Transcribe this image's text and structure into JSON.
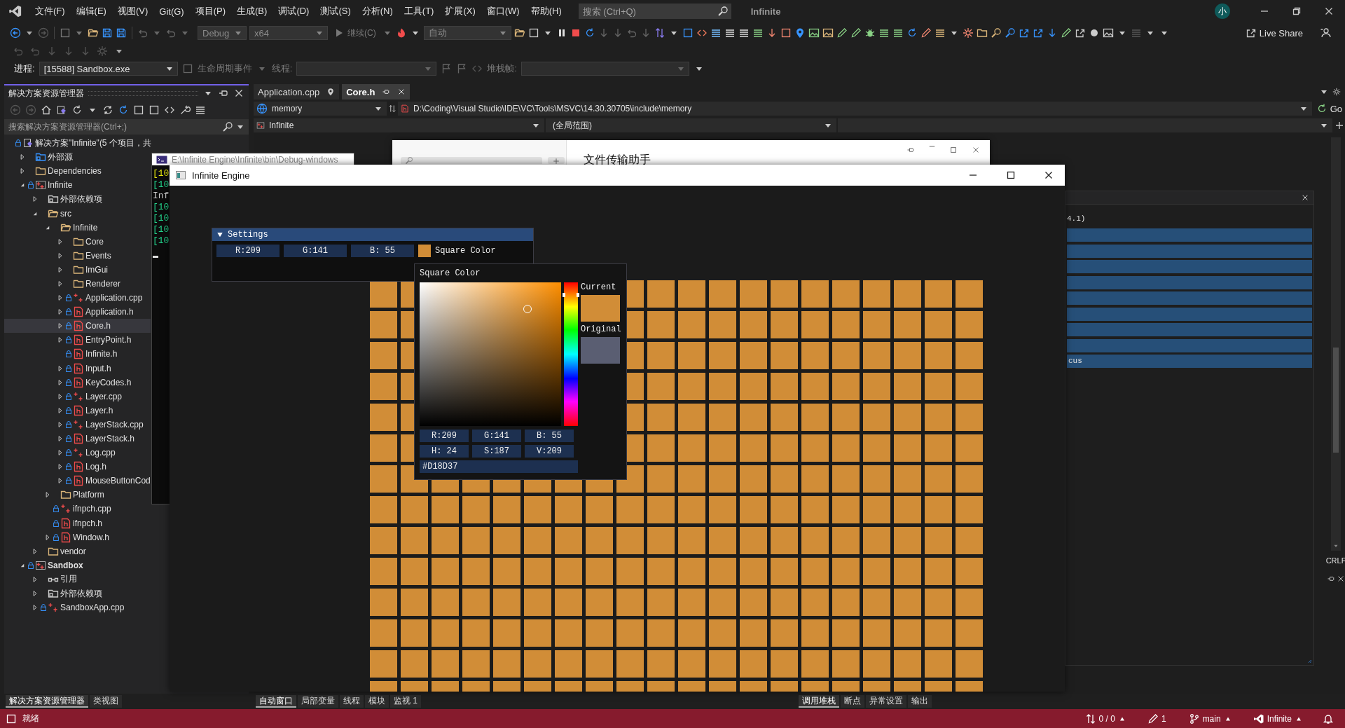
{
  "menubar": {
    "items": [
      "文件(F)",
      "编辑(E)",
      "视图(V)",
      "Git(G)",
      "项目(P)",
      "生成(B)",
      "调试(D)",
      "测试(S)",
      "分析(N)",
      "工具(T)",
      "扩展(X)",
      "窗口(W)",
      "帮助(H)"
    ],
    "search": {
      "placeholder": "搜索 (Ctrl+Q)"
    },
    "solution_name": "Infinite",
    "avatar": "小"
  },
  "toolbar": {
    "config": "Debug",
    "platform": "x64",
    "continue": "继续(C)",
    "mode": "自动",
    "live_share": "Live Share"
  },
  "debug_location": {
    "process_label": "进程:",
    "process": "[15588] Sandbox.exe",
    "lifecycle": "生命周期事件",
    "thread_label": "线程:",
    "stack_label": "堆栈帧:"
  },
  "explorer": {
    "title": "解决方案资源管理器",
    "search": {
      "placeholder": "搜索解决方案资源管理器(Ctrl+;)"
    },
    "tree": [
      {
        "label": "解决方案\"Infinite\"(5 个项目，共",
        "kind": "solution",
        "locked": true,
        "selected": false,
        "children": [
          {
            "label": "外部源",
            "kind": "extsrc",
            "locked": false,
            "selected": false,
            "expanded": false
          },
          {
            "label": "Dependencies",
            "kind": "folder",
            "locked": false,
            "selected": false,
            "expanded": false
          },
          {
            "label": "Infinite",
            "kind": "project",
            "locked": true,
            "selected": false,
            "expanded": true,
            "startup": false,
            "children": [
              {
                "label": "外部依赖项",
                "kind": "extdeps",
                "locked": false,
                "selected": false,
                "expanded": false
              },
              {
                "label": "src",
                "kind": "folder",
                "locked": false,
                "selected": false,
                "expanded": true,
                "children": [
                  {
                    "label": "Infinite",
                    "kind": "folder",
                    "locked": false,
                    "selected": false,
                    "expanded": true,
                    "children": [
                      {
                        "label": "Core",
                        "kind": "folder",
                        "locked": false,
                        "selected": false,
                        "expanded": false
                      },
                      {
                        "label": "Events",
                        "kind": "folder",
                        "locked": false,
                        "selected": false,
                        "expanded": false
                      },
                      {
                        "label": "ImGui",
                        "kind": "folder",
                        "locked": false,
                        "selected": false,
                        "expanded": false
                      },
                      {
                        "label": "Renderer",
                        "kind": "folder",
                        "locked": false,
                        "selected": false,
                        "expanded": false
                      },
                      {
                        "label": "Application.cpp",
                        "kind": "cpp",
                        "locked": true,
                        "selected": false,
                        "expanded": false
                      },
                      {
                        "label": "Application.h",
                        "kind": "h",
                        "locked": true,
                        "selected": false,
                        "expanded": false
                      },
                      {
                        "label": "Core.h",
                        "kind": "h",
                        "locked": true,
                        "selected": true,
                        "expanded": false
                      },
                      {
                        "label": "EntryPoint.h",
                        "kind": "h",
                        "locked": true,
                        "selected": false,
                        "expanded": false
                      },
                      {
                        "label": "Infinite.h",
                        "kind": "h",
                        "locked": true,
                        "selected": false
                      },
                      {
                        "label": "Input.h",
                        "kind": "h",
                        "locked": true,
                        "selected": false,
                        "expanded": false
                      },
                      {
                        "label": "KeyCodes.h",
                        "kind": "h",
                        "locked": true,
                        "selected": false,
                        "expanded": false
                      },
                      {
                        "label": "Layer.cpp",
                        "kind": "cpp",
                        "locked": true,
                        "selected": false,
                        "expanded": false
                      },
                      {
                        "label": "Layer.h",
                        "kind": "h",
                        "locked": true,
                        "selected": false,
                        "expanded": false
                      },
                      {
                        "label": "LayerStack.cpp",
                        "kind": "cpp",
                        "locked": true,
                        "selected": false,
                        "expanded": false
                      },
                      {
                        "label": "LayerStack.h",
                        "kind": "h",
                        "locked": true,
                        "selected": false,
                        "expanded": false
                      },
                      {
                        "label": "Log.cpp",
                        "kind": "cpp",
                        "locked": true,
                        "selected": false,
                        "expanded": false
                      },
                      {
                        "label": "Log.h",
                        "kind": "h",
                        "locked": true,
                        "selected": false,
                        "expanded": false
                      },
                      {
                        "label": "MouseButtonCod",
                        "kind": "h",
                        "locked": true,
                        "selected": false,
                        "expanded": false
                      }
                    ]
                  },
                  {
                    "label": "Platform",
                    "kind": "folder",
                    "locked": false,
                    "selected": false,
                    "expanded": false
                  },
                  {
                    "label": "ifnpch.cpp",
                    "kind": "cpp",
                    "locked": true,
                    "selected": false
                  },
                  {
                    "label": "ifnpch.h",
                    "kind": "h",
                    "locked": true,
                    "selected": false
                  },
                  {
                    "label": "Window.h",
                    "kind": "h",
                    "locked": true,
                    "selected": false,
                    "expanded": false
                  }
                ]
              },
              {
                "label": "vendor",
                "kind": "folder",
                "locked": false,
                "selected": false,
                "expanded": false
              }
            ]
          },
          {
            "label": "Sandbox",
            "kind": "project",
            "locked": true,
            "selected": false,
            "expanded": true,
            "startup": true,
            "children": [
              {
                "label": "引用",
                "kind": "refs",
                "locked": false,
                "selected": false,
                "expanded": false
              },
              {
                "label": "外部依赖项",
                "kind": "extdeps",
                "locked": false,
                "selected": false,
                "expanded": false
              },
              {
                "label": "SandboxApp.cpp",
                "kind": "cpp",
                "locked": true,
                "selected": false,
                "expanded": false
              }
            ]
          }
        ]
      }
    ]
  },
  "editor": {
    "tabs": [
      {
        "label": "Application.cpp",
        "selected": false,
        "pinned": true
      },
      {
        "label": "Core.h",
        "selected": true,
        "pinned": false
      }
    ],
    "navigation": {
      "scope": "memory",
      "path": "D:\\Coding\\Visual Studio\\IDE\\VC\\Tools\\MSVC\\14.30.30705\\include\\memory",
      "go": "Go",
      "project": "Infinite",
      "range": "(全局范围)"
    },
    "line_ending": "CRLF"
  },
  "console": {
    "title": "E:\\Infinite Engine\\Infinite\\bin\\Debug-windows",
    "lines": [
      {
        "text": "[10",
        "kind": "warn"
      },
      {
        "text": "[10",
        "kind": "info"
      },
      {
        "text": "Inf",
        "kind": "plain"
      },
      {
        "text": "[10",
        "kind": "info"
      },
      {
        "text": "[10",
        "kind": "info"
      },
      {
        "text": "[10",
        "kind": "info"
      },
      {
        "text": "[10",
        "kind": "info"
      }
    ]
  },
  "chat_window": {
    "title": "文件传输助手"
  },
  "watch_panel": {
    "header": "4.1)",
    "rows": [
      {
        "selected": true
      },
      {
        "selected": true
      },
      {
        "selected": true
      },
      {
        "selected": true
      },
      {
        "selected": true
      },
      {
        "selected": true
      },
      {
        "selected": true
      },
      {
        "selected": true
      },
      {
        "selected": true,
        "text": "cus"
      }
    ]
  },
  "engine": {
    "title": "Infinite Engine",
    "settings": {
      "title": "Settings",
      "expanded": true,
      "fields": [
        "R:209",
        "G:141",
        "B: 55"
      ],
      "label": "Square Color"
    },
    "picker": {
      "title": "Square Color",
      "current_label": "Current",
      "original_label": "Original",
      "rgb": [
        "R:209",
        "G:141",
        "B: 55"
      ],
      "hsv": [
        "H: 24",
        "S:187",
        "V:209"
      ],
      "hex": "#D18D37"
    }
  },
  "bottom_tabs": {
    "left": [
      {
        "label": "解决方案资源管理器",
        "selected": true
      },
      {
        "label": "类视图",
        "selected": false
      }
    ],
    "middle": [
      {
        "label": "自动窗口",
        "selected": true
      },
      {
        "label": "局部变量",
        "selected": false
      },
      {
        "label": "线程",
        "selected": false
      },
      {
        "label": "模块",
        "selected": false
      },
      {
        "label": "监视 1",
        "selected": false
      }
    ],
    "right": [
      {
        "label": "调用堆栈",
        "selected": true
      },
      {
        "label": "断点",
        "selected": false
      },
      {
        "label": "异常设置",
        "selected": false
      },
      {
        "label": "输出",
        "selected": false
      }
    ]
  },
  "status_bar": {
    "state": "就绪",
    "changes": "0 / 0",
    "edits": "1",
    "branch": "main",
    "repo": "Infinite"
  }
}
